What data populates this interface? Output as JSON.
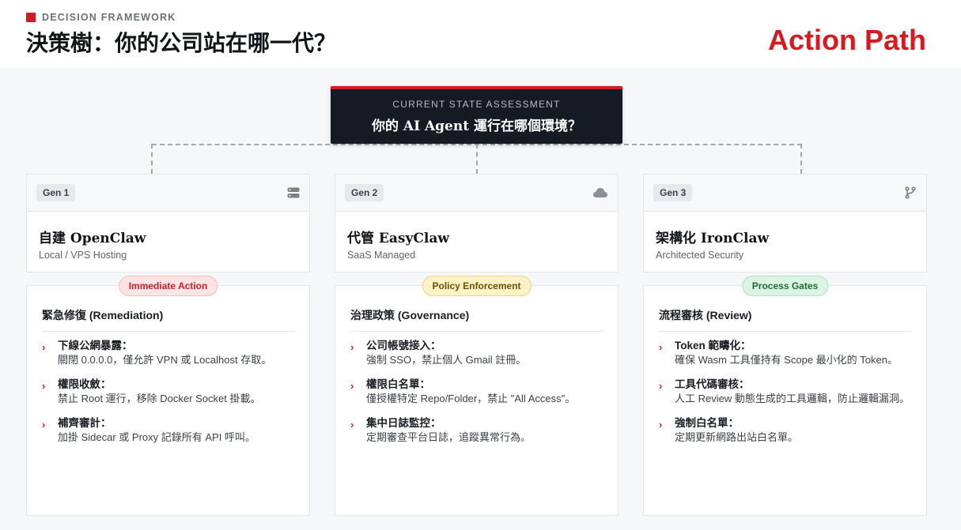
{
  "header": {
    "eyebrow": "DECISION FRAMEWORK",
    "title": "決策樹：你的公司站在哪一代？",
    "action_path": "Action Path",
    "accent_color": "#d71920"
  },
  "assessment": {
    "label": "CURRENT STATE ASSESSMENT",
    "question": "你的 AI Agent 運行在哪個環境？"
  },
  "columns": [
    {
      "gen": "Gen 1",
      "icon": "server-icon",
      "name": "自建 OpenClaw",
      "subtitle": "Local / VPS Hosting",
      "pill": "Immediate Action",
      "pill_color": "red",
      "section_title": "緊急修復 (Remediation)",
      "items": [
        {
          "title": "下線公網暴露：",
          "desc": "關閉 0.0.0.0，僅允許 VPN 或 Localhost 存取。"
        },
        {
          "title": "權限收斂：",
          "desc": "禁止 Root 運行，移除 Docker Socket 掛載。"
        },
        {
          "title": "補齊審計：",
          "desc": "加掛 Sidecar 或 Proxy 記錄所有 API 呼叫。"
        }
      ]
    },
    {
      "gen": "Gen 2",
      "icon": "cloud-icon",
      "name": "代管 EasyClaw",
      "subtitle": "SaaS Managed",
      "pill": "Policy Enforcement",
      "pill_color": "yellow",
      "section_title": "治理政策 (Governance)",
      "items": [
        {
          "title": "公司帳號接入：",
          "desc": "強制 SSO，禁止個人 Gmail 註冊。"
        },
        {
          "title": "權限白名單：",
          "desc": "僅授權特定 Repo/Folder，禁止 \"All Access\"。"
        },
        {
          "title": "集中日誌監控：",
          "desc": "定期審查平台日誌，追蹤異常行為。"
        }
      ]
    },
    {
      "gen": "Gen 3",
      "icon": "git-branch-icon",
      "name": "架構化 IronClaw",
      "subtitle": "Architected Security",
      "pill": "Process Gates",
      "pill_color": "green",
      "section_title": "流程審核 (Review)",
      "items": [
        {
          "title": "Token 範疇化：",
          "desc": "確保 Wasm 工具僅持有 Scope 最小化的 Token。"
        },
        {
          "title": "工具代碼審核：",
          "desc": "人工 Review 動態生成的工具邏輯，防止邏輯漏洞。"
        },
        {
          "title": "強制白名單：",
          "desc": "定期更新網路出站白名單。"
        }
      ]
    }
  ]
}
